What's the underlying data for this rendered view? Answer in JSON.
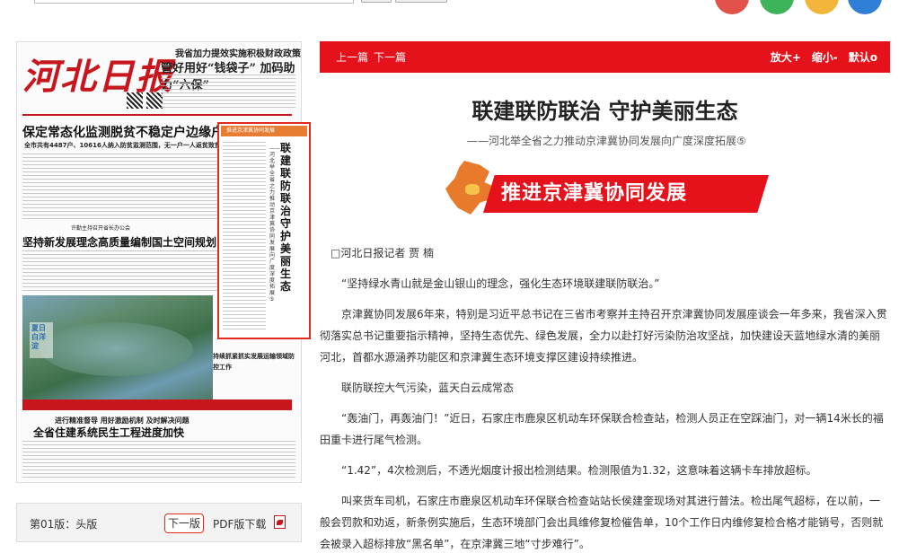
{
  "article_nav": {
    "prev": "上一篇",
    "next": "下一篇",
    "zoom_in": "放大+",
    "zoom_out": "缩小-",
    "default": "默认o"
  },
  "article": {
    "title": "联建联防联治 守护美丽生态",
    "subtitle": "——河北举全省之力推动京津冀协同发展向广度深度拓展⑤",
    "logo_text": "推进京津冀协同发展",
    "byline": "□河北日报记者 贾 楠",
    "paragraphs": [
      "“坚持绿水青山就是金山银山的理念，强化生态环境联建联防联治。”",
      "京津冀协同发展6年来，特别是习近平总书记在三省市考察并主持召开京津冀协同发展座谈会一年多来，我省深入贯彻落实总书记重要指示精神，坚持生态优先、绿色发展，全力以赴打好污染防治攻坚战，加快建设天蓝地绿水清的美丽河北，首都水源涵养功能区和京津冀生态环境支撑区建设持续推进。",
      "联防联控大气污染，蓝天白云成常态",
      "“轰油门，再轰油门！”近日，石家庄市鹿泉区机动车环保联合检查站，检测人员正在空踩油门，对一辆14米长的福田重卡进行尾气检测。",
      "“1.42”，4次检测后，不透光烟度计报出检测结果。检测限值为1.32，这意味着这辆卡车排放超标。",
      "叫来货车司机，石家庄市鹿泉区机动车环保联合检查站站长侯建奎现场对其进行普法。检出尾气超标，在以前，一般会罚款和劝返，新条例实施后，生态环境部门会出具维修复检催告单，10个工作日内维修复检合格才能销号，否则就会被录入超标排放“黑名单”，在京津冀三地“寸步难行”。"
    ]
  },
  "paper": {
    "masthead": "河北日报",
    "headline_top_small": "我省加力提效实施积极财政政策",
    "headline_top": "管好用好“钱袋子” 加码助力“六保”",
    "headline_main": "保定常态化监测脱贫不稳定户边缘户",
    "headline_main_sub": "全市共有4487户、10616人纳入防贫监测范围，无一户一人返贫致贫",
    "headline_mid_small": "许勤主持召开省长办公会",
    "headline_mid": "坚持新发展理念高质量编制国土空间规划",
    "summer_label": "夏日白洋淀",
    "side_headlines": "持续抓紧抓实发展运输领域防控工作",
    "sub_headline": "进行精准督导 用好激励机制 及时解决问题",
    "headline_bottom": "全省住建系统民生工程进度加快",
    "highlight_tag": "推进京津冀协同发展",
    "highlight_title": "联建联防联治 守护美丽生态",
    "highlight_sub": "——河北举全省之力推动京津冀协同发展向广度深度拓展⑤"
  },
  "pagenav": {
    "current": "第01版：头版",
    "next": "下一版",
    "pdf": "PDF版下载"
  },
  "colors": {
    "brand_red": "#e6121b",
    "logo_orange": "#e87a2b",
    "highlight_border": "#e32a1e"
  }
}
